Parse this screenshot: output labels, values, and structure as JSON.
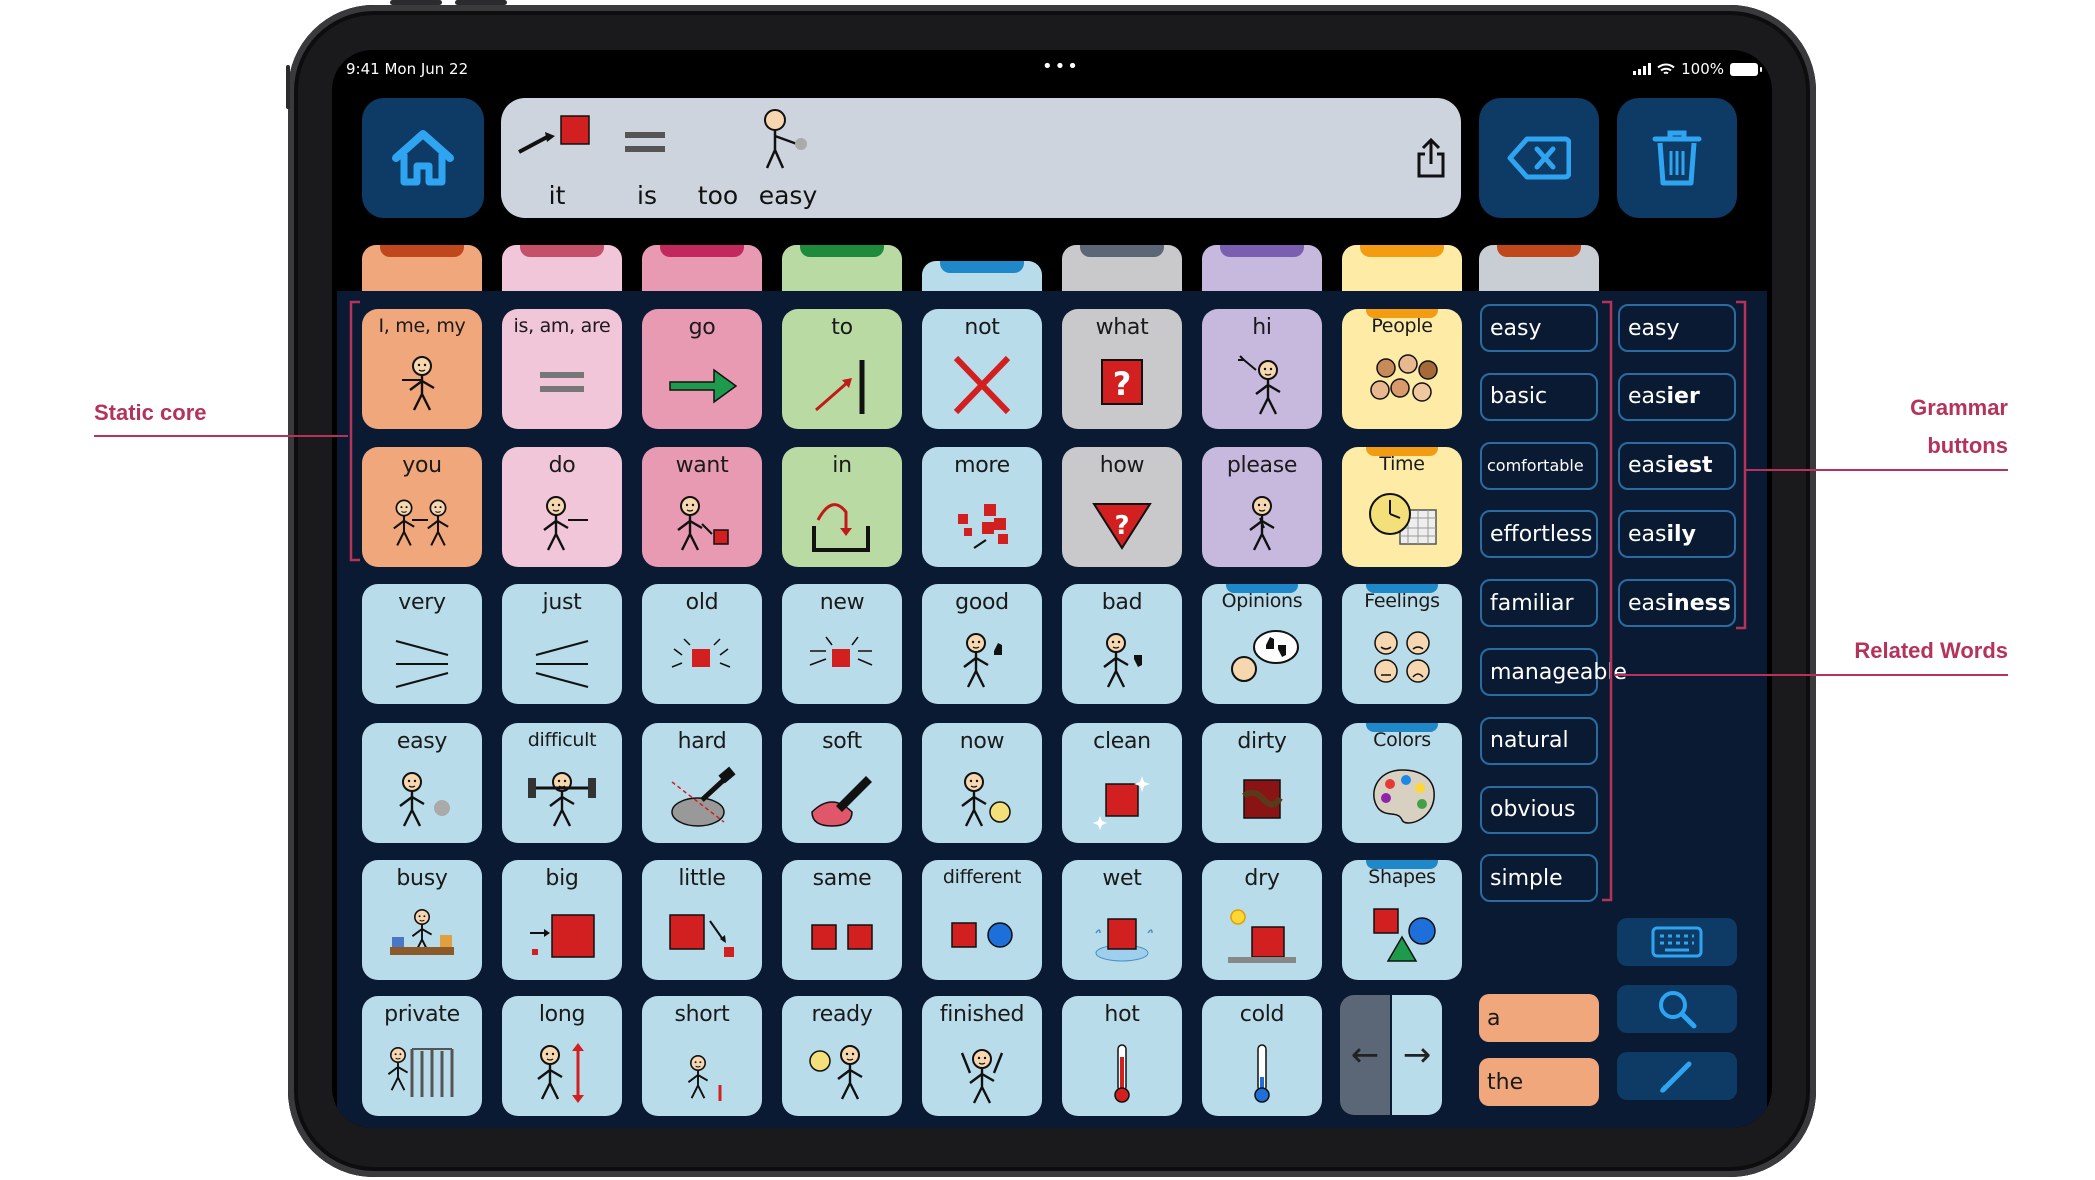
{
  "status": {
    "time": "9:41  Mon Jun 22",
    "battery": "100%"
  },
  "message": {
    "words": [
      "it",
      "is",
      "too",
      "easy"
    ]
  },
  "colors": {
    "person": "#f1a77c",
    "verb": "#f0c6d8",
    "verb2": "#e99ab3",
    "preposition": "#b9dba3",
    "negation": "#b9dcea",
    "question": "#c9c9cc",
    "social": "#c7b9de",
    "folder": "#fdeba6",
    "descriptor": "#b9dcea",
    "panel": "#0b1a33",
    "dark_button": "#0d3b66",
    "annotation": "#b5335a"
  },
  "grid": [
    [
      {
        "label": "I, me, my",
        "icon": "person-me-icon",
        "color": "#f1a77c"
      },
      {
        "label": "is, am, are",
        "icon": "equals-icon",
        "color": "#f0c6d8"
      },
      {
        "label": "go",
        "icon": "green-arrow-icon",
        "color": "#e99ab3"
      },
      {
        "label": "to",
        "icon": "arrow-to-line-icon",
        "color": "#b9dba3"
      },
      {
        "label": "not",
        "icon": "red-cross-icon",
        "color": "#b9dcea"
      },
      {
        "label": "what",
        "icon": "question-box-icon",
        "color": "#c9c9cc"
      },
      {
        "label": "hi",
        "icon": "waving-person-icon",
        "color": "#c7b9de"
      },
      {
        "label": "People",
        "icon": "people-group-icon",
        "color": "#fdeba6",
        "folder": true,
        "stripe": "#f39c12"
      }
    ],
    [
      {
        "label": "you",
        "icon": "people-pointing-icon",
        "color": "#f1a77c"
      },
      {
        "label": "do",
        "icon": "person-doing-icon",
        "color": "#f0c6d8"
      },
      {
        "label": "want",
        "icon": "person-want-icon",
        "color": "#e99ab3"
      },
      {
        "label": "in",
        "icon": "arrow-into-box-icon",
        "color": "#b9dba3"
      },
      {
        "label": "more",
        "icon": "more-cubes-icon",
        "color": "#b9dcea"
      },
      {
        "label": "how",
        "icon": "question-triangle-icon",
        "color": "#c9c9cc"
      },
      {
        "label": "please",
        "icon": "person-please-icon",
        "color": "#c7b9de"
      },
      {
        "label": "Time",
        "icon": "clock-calendar-icon",
        "color": "#fdeba6",
        "folder": true,
        "stripe": "#f39c12"
      }
    ],
    [
      {
        "label": "very",
        "icon": "very-lines-icon",
        "color": "#b9dcea"
      },
      {
        "label": "just",
        "icon": "just-lines-icon",
        "color": "#b9dcea"
      },
      {
        "label": "old",
        "icon": "old-cube-icon",
        "color": "#b9dcea"
      },
      {
        "label": "new",
        "icon": "new-cube-icon",
        "color": "#b9dcea"
      },
      {
        "label": "good",
        "icon": "thumbs-up-person-icon",
        "color": "#b9dcea"
      },
      {
        "label": "bad",
        "icon": "thumbs-down-person-icon",
        "color": "#b9dcea"
      },
      {
        "label": "Opinions",
        "icon": "opinion-bubble-icon",
        "color": "#b9dcea",
        "folder": true,
        "stripe": "#1e88c8"
      },
      {
        "label": "Feelings",
        "icon": "faces-icon",
        "color": "#b9dcea",
        "folder": true,
        "stripe": "#1e88c8"
      }
    ],
    [
      {
        "label": "easy",
        "icon": "person-easy-icon",
        "color": "#b9dcea"
      },
      {
        "label": "difficult",
        "icon": "weightlifter-icon",
        "color": "#b9dcea"
      },
      {
        "label": "hard",
        "icon": "hammer-rock-icon",
        "color": "#b9dcea"
      },
      {
        "label": "soft",
        "icon": "soft-press-icon",
        "color": "#b9dcea"
      },
      {
        "label": "now",
        "icon": "person-clock-icon",
        "color": "#b9dcea"
      },
      {
        "label": "clean",
        "icon": "sparkle-cube-icon",
        "color": "#b9dcea"
      },
      {
        "label": "dirty",
        "icon": "dirty-cube-icon",
        "color": "#b9dcea"
      },
      {
        "label": "Colors",
        "icon": "palette-icon",
        "color": "#b9dcea",
        "folder": true,
        "stripe": "#1e88c8"
      }
    ],
    [
      {
        "label": "busy",
        "icon": "busy-desk-icon",
        "color": "#b9dcea"
      },
      {
        "label": "big",
        "icon": "big-square-icon",
        "color": "#b9dcea"
      },
      {
        "label": "little",
        "icon": "little-square-icon",
        "color": "#b9dcea"
      },
      {
        "label": "same",
        "icon": "same-squares-icon",
        "color": "#b9dcea"
      },
      {
        "label": "different",
        "icon": "square-circle-icon",
        "color": "#b9dcea"
      },
      {
        "label": "wet",
        "icon": "wet-cube-icon",
        "color": "#b9dcea"
      },
      {
        "label": "dry",
        "icon": "sun-cube-icon",
        "color": "#b9dcea"
      },
      {
        "label": "Shapes",
        "icon": "shapes-icon",
        "color": "#b9dcea",
        "folder": true,
        "stripe": "#1e88c8"
      }
    ],
    [
      {
        "label": "private",
        "icon": "screen-person-icon",
        "color": "#b9dcea"
      },
      {
        "label": "long",
        "icon": "long-arrow-icon",
        "color": "#b9dcea"
      },
      {
        "label": "short",
        "icon": "short-person-icon",
        "color": "#b9dcea"
      },
      {
        "label": "ready",
        "icon": "ready-person-icon",
        "color": "#b9dcea"
      },
      {
        "label": "finished",
        "icon": "finished-person-icon",
        "color": "#b9dcea"
      },
      {
        "label": "hot",
        "icon": "hot-thermometer-icon",
        "color": "#b9dcea"
      },
      {
        "label": "cold",
        "icon": "cold-thermometer-icon",
        "color": "#b9dcea"
      }
    ]
  ],
  "tabs": [
    {
      "color": "#f1a77c",
      "stripe": "#c0461c"
    },
    {
      "color": "#f0c6d8",
      "stripe": "#c4506a"
    },
    {
      "color": "#e99ab3",
      "stripe": "#c2285e"
    },
    {
      "color": "#b9dba3",
      "stripe": "#1e8a3c"
    },
    {
      "color": "#b9dcea",
      "stripe": "#1e88c8"
    },
    {
      "color": "#c9c9cc",
      "stripe": "#5b6777"
    },
    {
      "color": "#c7b9de",
      "stripe": "#7a5fb0"
    },
    {
      "color": "#fdeba6",
      "stripe": "#f39c12"
    },
    {
      "color": "#c9cdd4",
      "stripe": "#c0461c"
    }
  ],
  "nav": {
    "left": "←",
    "right": "→"
  },
  "related_words": [
    "easy",
    "basic",
    "comfortable",
    "effortless",
    "familiar",
    "manageable",
    "natural",
    "obvious",
    "simple"
  ],
  "grammar": [
    {
      "stem": "eas",
      "suffix": "y"
    },
    {
      "stem": "eas",
      "suffix": "ier"
    },
    {
      "stem": "eas",
      "suffix": "iest"
    },
    {
      "stem": "eas",
      "suffix": "ily"
    },
    {
      "stem": "eas",
      "suffix": "iness"
    }
  ],
  "articles": [
    "a",
    "the"
  ],
  "annotations": {
    "static_core": "Static core",
    "grammar_line1": "Grammar",
    "grammar_line2": "buttons",
    "related": "Related Words"
  }
}
